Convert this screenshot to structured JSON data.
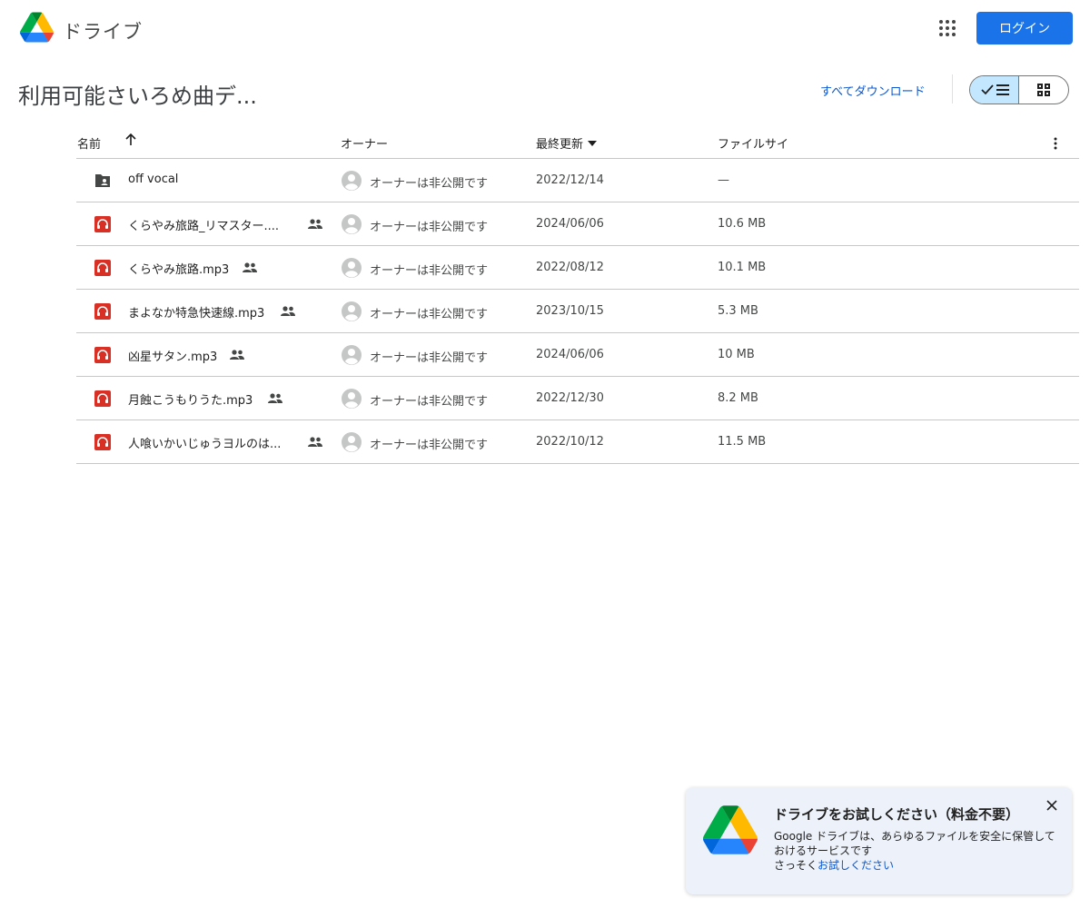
{
  "header": {
    "app_name": "ドライブ",
    "login_label": "ログイン",
    "apps_icon": "apps-grid-icon"
  },
  "folder": {
    "title": "利用可能さいろめ曲デ...",
    "download_all_label": "すべてダウンロード",
    "view_mode": "list"
  },
  "table": {
    "columns": {
      "name": "名前",
      "owner": "オーナー",
      "modified": "最終更新",
      "size": "ファイルサイ"
    },
    "sort": {
      "column": "name",
      "direction": "ascending"
    },
    "rows": [
      {
        "name": "off vocal",
        "type": "folder",
        "shared": false,
        "owner": "オーナーは非公開です",
        "modified": "2022/12/14",
        "size": "—"
      },
      {
        "name": "くらやみ旅路_リマスター....",
        "type": "audio",
        "shared": true,
        "owner": "オーナーは非公開です",
        "modified": "2024/06/06",
        "size": "10.6 MB"
      },
      {
        "name": "くらやみ旅路.mp3",
        "type": "audio",
        "shared": true,
        "owner": "オーナーは非公開です",
        "modified": "2022/08/12",
        "size": "10.1 MB"
      },
      {
        "name": "まよなか特急快速線.mp3",
        "type": "audio",
        "shared": true,
        "owner": "オーナーは非公開です",
        "modified": "2023/10/15",
        "size": "5.3 MB"
      },
      {
        "name": "凶星サタン.mp3",
        "type": "audio",
        "shared": true,
        "owner": "オーナーは非公開です",
        "modified": "2024/06/06",
        "size": "10 MB"
      },
      {
        "name": "月蝕こうもりうた.mp3",
        "type": "audio",
        "shared": true,
        "owner": "オーナーは非公開です",
        "modified": "2022/12/30",
        "size": "8.2 MB"
      },
      {
        "name": "人喰いかいじゅうヨルのは...",
        "type": "audio",
        "shared": true,
        "owner": "オーナーは非公開です",
        "modified": "2022/10/12",
        "size": "11.5 MB"
      }
    ]
  },
  "promo": {
    "title": "ドライブをお試しください（料金不要）",
    "body": "Google ドライブは、あらゆるファイルを安全に保管しておけるサービスです",
    "link_prefix": "さっそく",
    "link_label": "お試しください"
  },
  "colors": {
    "accent": "#1a73e8",
    "link": "#0b57d0",
    "audio_icon": "#d93025",
    "selected_view": "#c2e7ff",
    "promo_bg": "#edf2fa"
  }
}
